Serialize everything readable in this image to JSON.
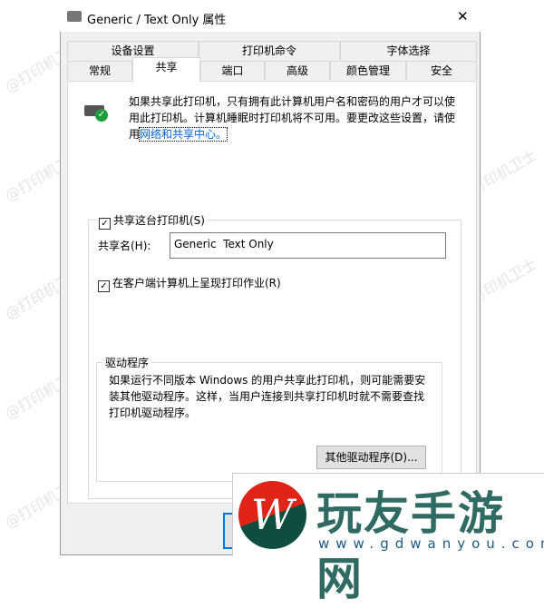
{
  "window": {
    "title": "Generic / Text Only 属性",
    "close": "✕"
  },
  "tabs_row1": [
    "设备设置",
    "打印机命令",
    "字体选择"
  ],
  "tabs_row2": [
    "常规",
    "共享",
    "端口",
    "高级",
    "颜色管理",
    "安全"
  ],
  "active_tab": "共享",
  "info": {
    "text": "如果共享此打印机，只有拥有此计算机用户名和密码的用户才可以使用此打印机。计算机睡眠时打印机将不可用。要更改这些设置，请使用",
    "link": "网络和共享中心。"
  },
  "share_checkbox": {
    "label": "共享这台打印机(S)",
    "checked": true
  },
  "share_name": {
    "label": "共享名(H):",
    "value": "Generic  Text Only"
  },
  "render_checkbox": {
    "label": "在客户端计算机上呈现打印作业(R)",
    "checked": true
  },
  "drivers": {
    "title": "驱动程序",
    "text": "如果运行不同版本 Windows 的用户共享此打印机，则可能需要安装其他驱动程序。这样，当用户连接到共享打印机时就不需要查找打印机驱动程序。",
    "button": "其他驱动程序(D)..."
  },
  "watermark": "@打印机卫士",
  "logo": {
    "name": "玩友手游网",
    "url": "www.gdwanyou.com"
  },
  "colors": {
    "link": "#0066cc",
    "logo_red": "#e02418",
    "logo_green": "#0f4d40",
    "logo_text": "#2f6a63"
  }
}
